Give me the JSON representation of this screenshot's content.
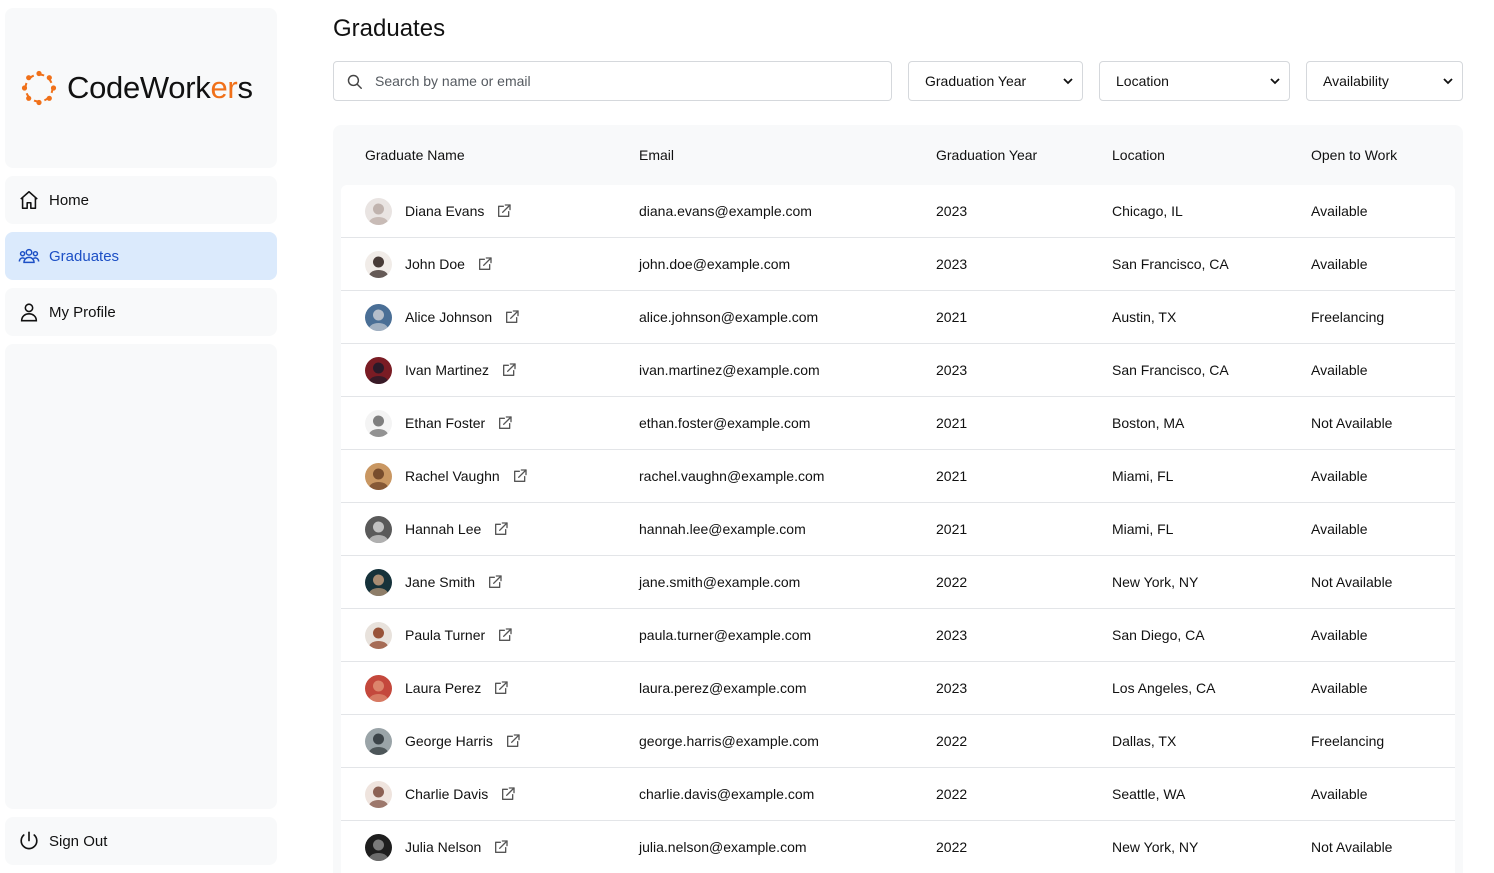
{
  "brand": {
    "name_main": "CodeWork",
    "name_accent": "er",
    "name_tail": "s",
    "accent_color": "#f07019"
  },
  "sidebar": {
    "items": [
      {
        "label": "Home",
        "icon": "home-icon",
        "active": false
      },
      {
        "label": "Graduates",
        "icon": "users-icon",
        "active": true
      },
      {
        "label": "My Profile",
        "icon": "user-icon",
        "active": false
      }
    ],
    "sign_out_label": "Sign Out"
  },
  "page": {
    "title": "Graduates"
  },
  "filters": {
    "search_placeholder": "Search by name or email",
    "graduation_year": "Graduation Year",
    "location": "Location",
    "availability": "Availability"
  },
  "table": {
    "headers": [
      "Graduate Name",
      "Email",
      "Graduation Year",
      "Location",
      "Open to Work"
    ],
    "rows": [
      {
        "name": "Diana Evans",
        "email": "diana.evans@example.com",
        "year": "2023",
        "location": "Chicago, IL",
        "status": "Available"
      },
      {
        "name": "John Doe",
        "email": "john.doe@example.com",
        "year": "2023",
        "location": "San Francisco, CA",
        "status": "Available"
      },
      {
        "name": "Alice Johnson",
        "email": "alice.johnson@example.com",
        "year": "2021",
        "location": "Austin, TX",
        "status": "Freelancing"
      },
      {
        "name": "Ivan Martinez",
        "email": "ivan.martinez@example.com",
        "year": "2023",
        "location": "San Francisco, CA",
        "status": "Available"
      },
      {
        "name": "Ethan Foster",
        "email": "ethan.foster@example.com",
        "year": "2021",
        "location": "Boston, MA",
        "status": "Not Available"
      },
      {
        "name": "Rachel Vaughn",
        "email": "rachel.vaughn@example.com",
        "year": "2021",
        "location": "Miami, FL",
        "status": "Available"
      },
      {
        "name": "Hannah Lee",
        "email": "hannah.lee@example.com",
        "year": "2021",
        "location": "Miami, FL",
        "status": "Available"
      },
      {
        "name": "Jane Smith",
        "email": "jane.smith@example.com",
        "year": "2022",
        "location": "New York, NY",
        "status": "Not Available"
      },
      {
        "name": "Paula Turner",
        "email": "paula.turner@example.com",
        "year": "2023",
        "location": "San Diego, CA",
        "status": "Available"
      },
      {
        "name": "Laura Perez",
        "email": "laura.perez@example.com",
        "year": "2023",
        "location": "Los Angeles, CA",
        "status": "Available"
      },
      {
        "name": "George Harris",
        "email": "george.harris@example.com",
        "year": "2022",
        "location": "Dallas, TX",
        "status": "Freelancing"
      },
      {
        "name": "Charlie Davis",
        "email": "charlie.davis@example.com",
        "year": "2022",
        "location": "Seattle, WA",
        "status": "Available"
      },
      {
        "name": "Julia Nelson",
        "email": "julia.nelson@example.com",
        "year": "2022",
        "location": "New York, NY",
        "status": "Not Available"
      }
    ]
  },
  "avatar_colors": [
    [
      "#e9e4e2",
      "#b9aaa4"
    ],
    [
      "#f1ece8",
      "#2a1c18"
    ],
    [
      "#4a6f96",
      "#c8cdd4"
    ],
    [
      "#7a1c24",
      "#1c1a2a"
    ],
    [
      "#f4f4f4",
      "#6a6a6a"
    ],
    [
      "#c99762",
      "#6a3f24"
    ],
    [
      "#5a5a5a",
      "#d4d4d4"
    ],
    [
      "#16323a",
      "#c29c7c"
    ],
    [
      "#e8e2dc",
      "#8a3a1c"
    ],
    [
      "#c4483c",
      "#e09074"
    ],
    [
      "#9aa4a8",
      "#2c3438"
    ],
    [
      "#efe4de",
      "#7a4a3c"
    ],
    [
      "#1e1e1e",
      "#8c8c8c"
    ]
  ]
}
